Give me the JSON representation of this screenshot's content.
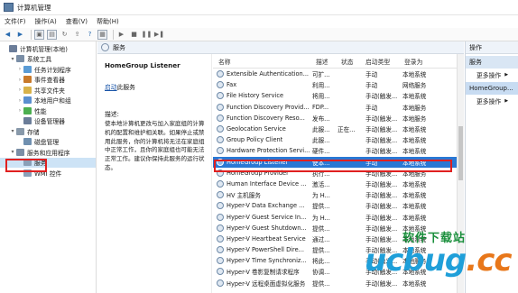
{
  "window": {
    "title": "计算机管理"
  },
  "menu": [
    "文件(F)",
    "操作(A)",
    "查看(V)",
    "帮助(H)"
  ],
  "tree": [
    {
      "label": "计算机管理(本地)",
      "level": 0,
      "arrow": "",
      "color": "#6b7d99"
    },
    {
      "label": "系统工具",
      "level": 1,
      "arrow": "▾",
      "color": "#7a8ea6"
    },
    {
      "label": "任务计划程序",
      "level": 2,
      "arrow": "›",
      "color": "#5a9bd5"
    },
    {
      "label": "事件查看器",
      "level": 2,
      "arrow": "›",
      "color": "#c97a2b"
    },
    {
      "label": "共享文件夹",
      "level": 2,
      "arrow": "›",
      "color": "#d8b24a"
    },
    {
      "label": "本地用户和组",
      "level": 2,
      "arrow": "›",
      "color": "#5a8fd0"
    },
    {
      "label": "性能",
      "level": 2,
      "arrow": "›",
      "color": "#4caf50"
    },
    {
      "label": "设备管理器",
      "level": 2,
      "arrow": "",
      "color": "#6b7d99"
    },
    {
      "label": "存储",
      "level": 1,
      "arrow": "▾",
      "color": "#8899aa"
    },
    {
      "label": "磁盘管理",
      "level": 2,
      "arrow": "",
      "color": "#7090b0"
    },
    {
      "label": "服务和应用程序",
      "level": 1,
      "arrow": "▾",
      "color": "#7a8ea6"
    },
    {
      "label": "服务",
      "level": 2,
      "arrow": "",
      "color": "#8aa0b8",
      "selected": true
    },
    {
      "label": "WMI 控件",
      "level": 2,
      "arrow": "",
      "color": "#8aa0b8"
    }
  ],
  "center": {
    "header": "服务"
  },
  "description": {
    "service_title": "HomeGroup Listener",
    "start_link": "启动",
    "start_suffix": "此服务",
    "desc_label": "描述:",
    "desc_text": "使本地计算机更改与加入家庭组的计算机的配置和维护相关联。如果停止或禁用此服务，你的计算机将无法在家庭组中正常工作，且你的家庭组也可能无法正常工作。建议你保持此服务的运行状态。"
  },
  "list": {
    "columns": [
      "名称",
      "描述",
      "状态",
      "启动类型",
      "登录为"
    ],
    "rows": [
      {
        "name": "Extensible Authentication...",
        "desc": "可扩...",
        "status": "",
        "start": "手动",
        "logon": "本地系统"
      },
      {
        "name": "Fax",
        "desc": "利用...",
        "status": "",
        "start": "手动",
        "logon": "网络服务"
      },
      {
        "name": "File History Service",
        "desc": "将用...",
        "status": "",
        "start": "手动(触发...",
        "logon": "本地系统"
      },
      {
        "name": "Function Discovery Provid...",
        "desc": "FDP...",
        "status": "",
        "start": "手动",
        "logon": "本地服务"
      },
      {
        "name": "Function Discovery Reso...",
        "desc": "发布...",
        "status": "",
        "start": "手动(触发...",
        "logon": "本地服务"
      },
      {
        "name": "Geolocation Service",
        "desc": "此服...",
        "status": "正在...",
        "start": "手动(触发...",
        "logon": "本地系统"
      },
      {
        "name": "Group Policy Client",
        "desc": "此服...",
        "status": "",
        "start": "手动(触发...",
        "logon": "本地系统"
      },
      {
        "name": "Hardware Protection Servi...",
        "desc": "硬件...",
        "status": "",
        "start": "手动(触发...",
        "logon": "本地系统"
      },
      {
        "name": "HomeGroup Listener",
        "desc": "使本...",
        "status": "",
        "start": "手动",
        "logon": "本地系统",
        "selected": true
      },
      {
        "name": "HomeGroup Provider",
        "desc": "执行...",
        "status": "",
        "start": "手动(触发...",
        "logon": "本地服务"
      },
      {
        "name": "Human Interface Device ...",
        "desc": "激活...",
        "status": "",
        "start": "手动(触发...",
        "logon": "本地系统"
      },
      {
        "name": "HV 主机服务",
        "desc": "为 H...",
        "status": "",
        "start": "手动(触发...",
        "logon": "本地系统"
      },
      {
        "name": "Hyper-V Data Exchange ...",
        "desc": "提供...",
        "status": "",
        "start": "手动(触发...",
        "logon": "本地系统"
      },
      {
        "name": "Hyper-V Guest Service In...",
        "desc": "为 H...",
        "status": "",
        "start": "手动(触发...",
        "logon": "本地系统"
      },
      {
        "name": "Hyper-V Guest Shutdown...",
        "desc": "提供...",
        "status": "",
        "start": "手动(触发...",
        "logon": "本地系统"
      },
      {
        "name": "Hyper-V Heartbeat Service",
        "desc": "通过...",
        "status": "",
        "start": "手动(触发...",
        "logon": "本地系统"
      },
      {
        "name": "Hyper-V PowerShell Dire...",
        "desc": "提供...",
        "status": "",
        "start": "手动(触发...",
        "logon": "本地系统"
      },
      {
        "name": "Hyper-V Time Synchroniz...",
        "desc": "将此...",
        "status": "",
        "start": "手动(触发...",
        "logon": "本地服务"
      },
      {
        "name": "Hyper-V 卷影复制请求程序",
        "desc": "协调...",
        "status": "",
        "start": "手动(触发...",
        "logon": "本地系统"
      },
      {
        "name": "Hyper-V 远程桌面虚拟化服务",
        "desc": "提供...",
        "status": "",
        "start": "手动(触发...",
        "logon": "本地系统"
      }
    ]
  },
  "actions": {
    "header": "操作",
    "group1": "服务",
    "group2": "HomeGroup...",
    "more1": "更多操作",
    "more2": "更多操作"
  },
  "watermark": {
    "top": "软件下载站",
    "main_a": "u",
    "main_b": "cbug",
    "main_c": "cc"
  },
  "colors": {
    "highlight": "#e02020",
    "selected_row": "#2a78d4",
    "link": "#1a55a8"
  }
}
